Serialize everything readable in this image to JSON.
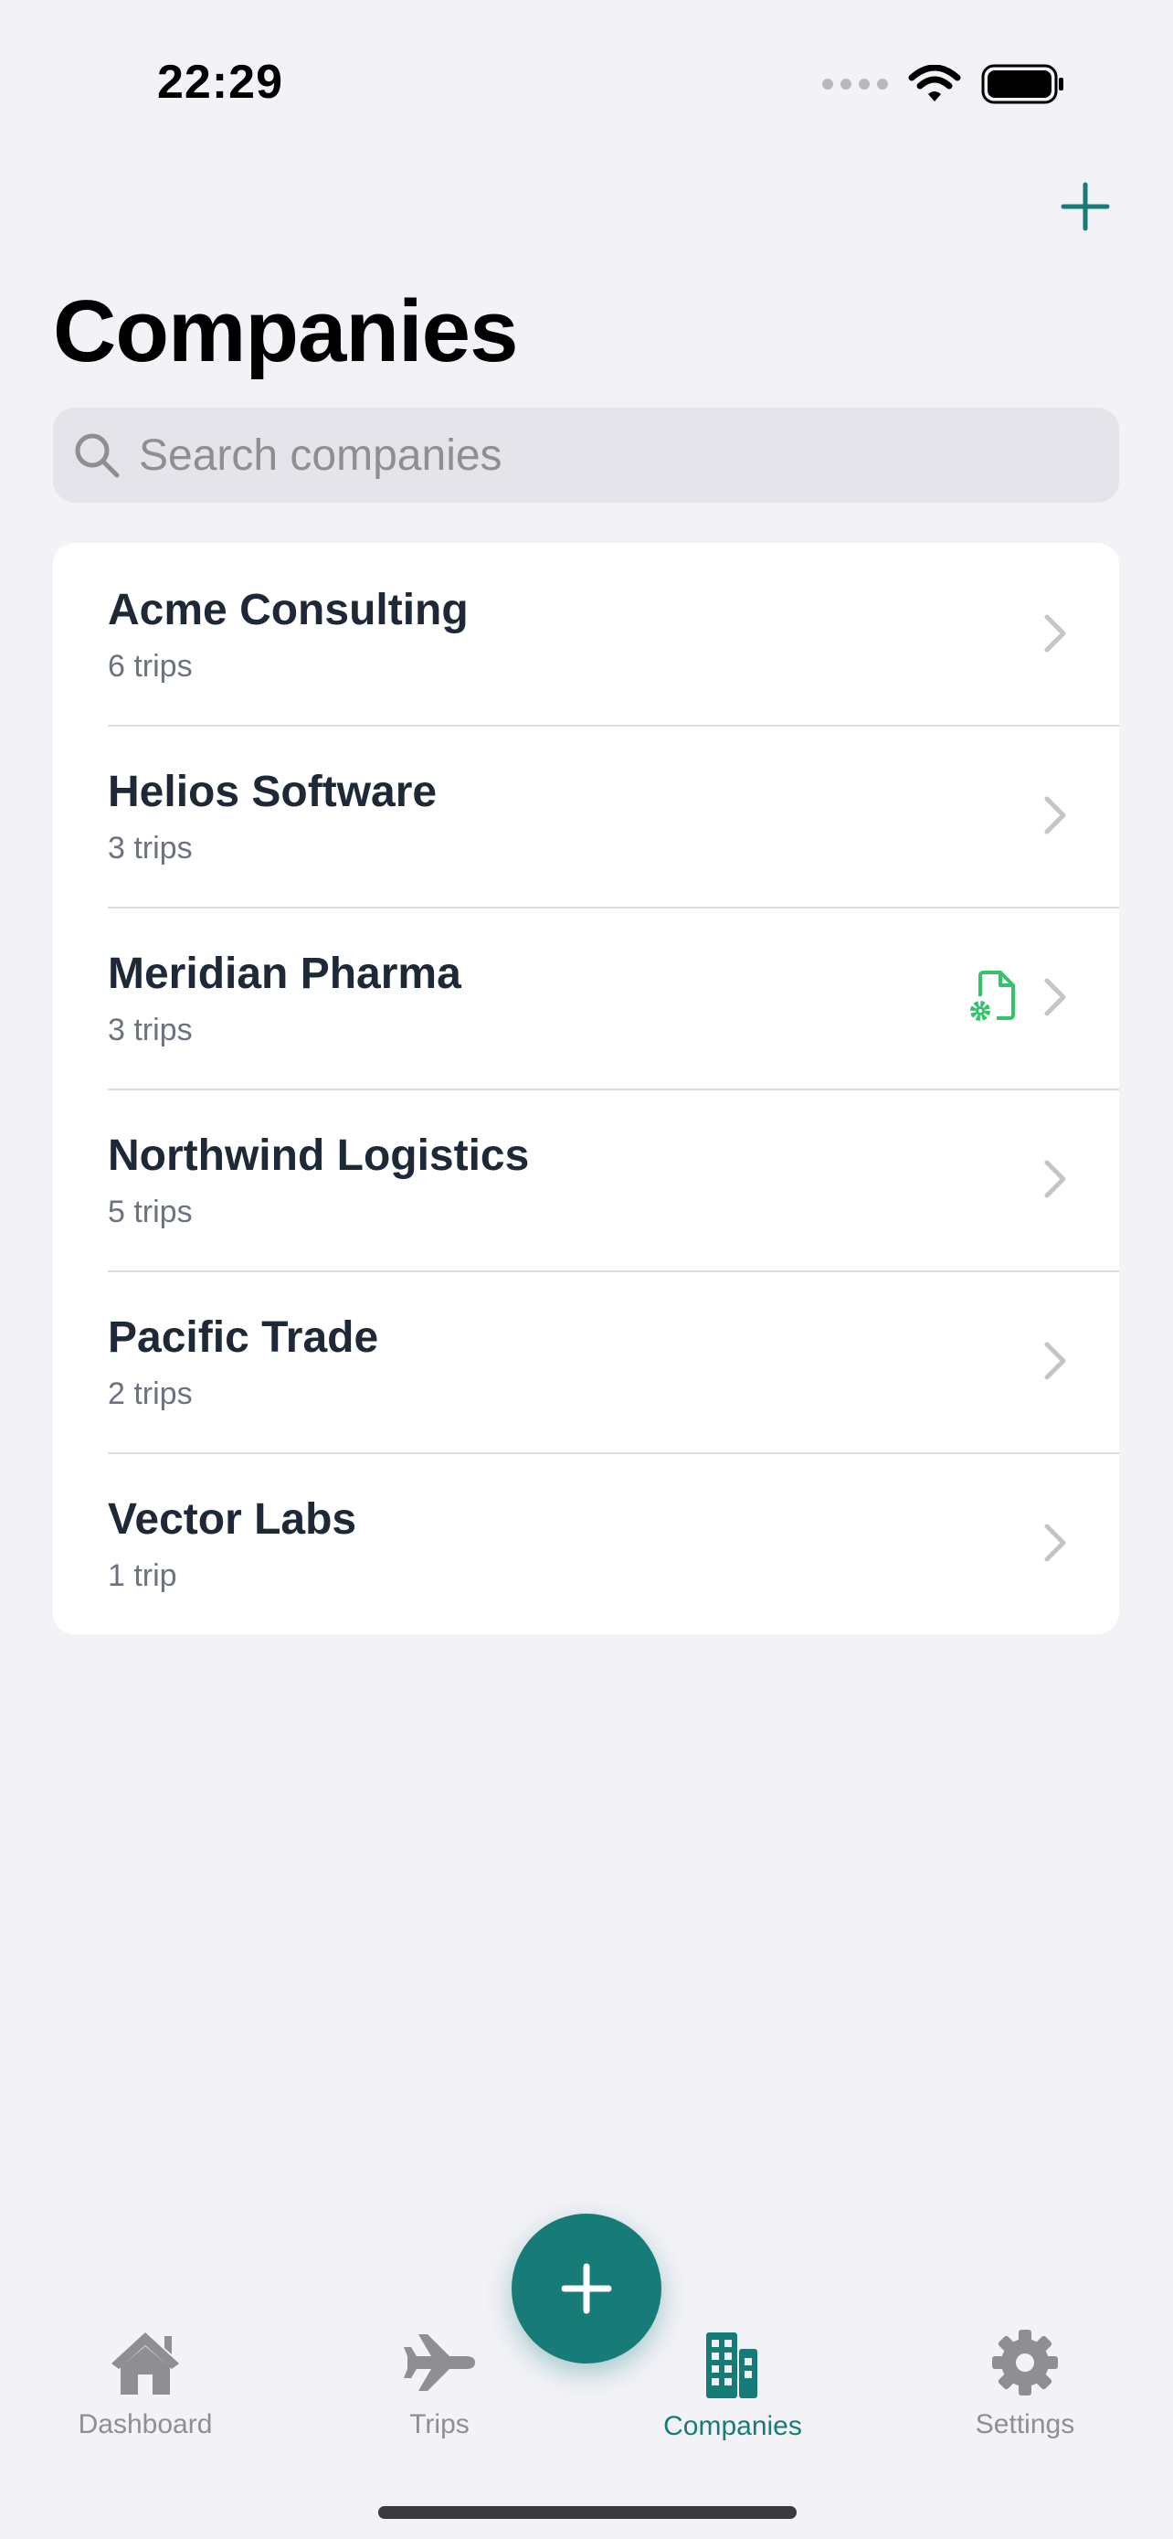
{
  "status": {
    "time": "22:29"
  },
  "header": {
    "title": "Companies"
  },
  "search": {
    "placeholder": "Search companies",
    "value": ""
  },
  "companies": [
    {
      "name": "Acme Consulting",
      "subtitle": "6 trips"
    },
    {
      "name": "Helios Software",
      "subtitle": "3 trips"
    },
    {
      "name": "Meridian Pharma",
      "subtitle": "3 trips",
      "icon": "document-gear-icon"
    },
    {
      "name": "Northwind Logistics",
      "subtitle": "5 trips"
    },
    {
      "name": "Pacific Trade",
      "subtitle": "2 trips"
    },
    {
      "name": "Vector Labs",
      "subtitle": "1 trip"
    }
  ],
  "tabbar": {
    "items": [
      {
        "label": "Dashboard",
        "icon": "house-icon"
      },
      {
        "label": "Trips",
        "icon": "airplane-icon"
      },
      {
        "label": "Companies",
        "icon": "building-icon",
        "active": true
      },
      {
        "label": "Settings",
        "icon": "gear-icon"
      }
    ]
  },
  "colors": {
    "accent": "#177b78",
    "doc_icon": "#34c26b",
    "background": "#f2f2f7"
  }
}
